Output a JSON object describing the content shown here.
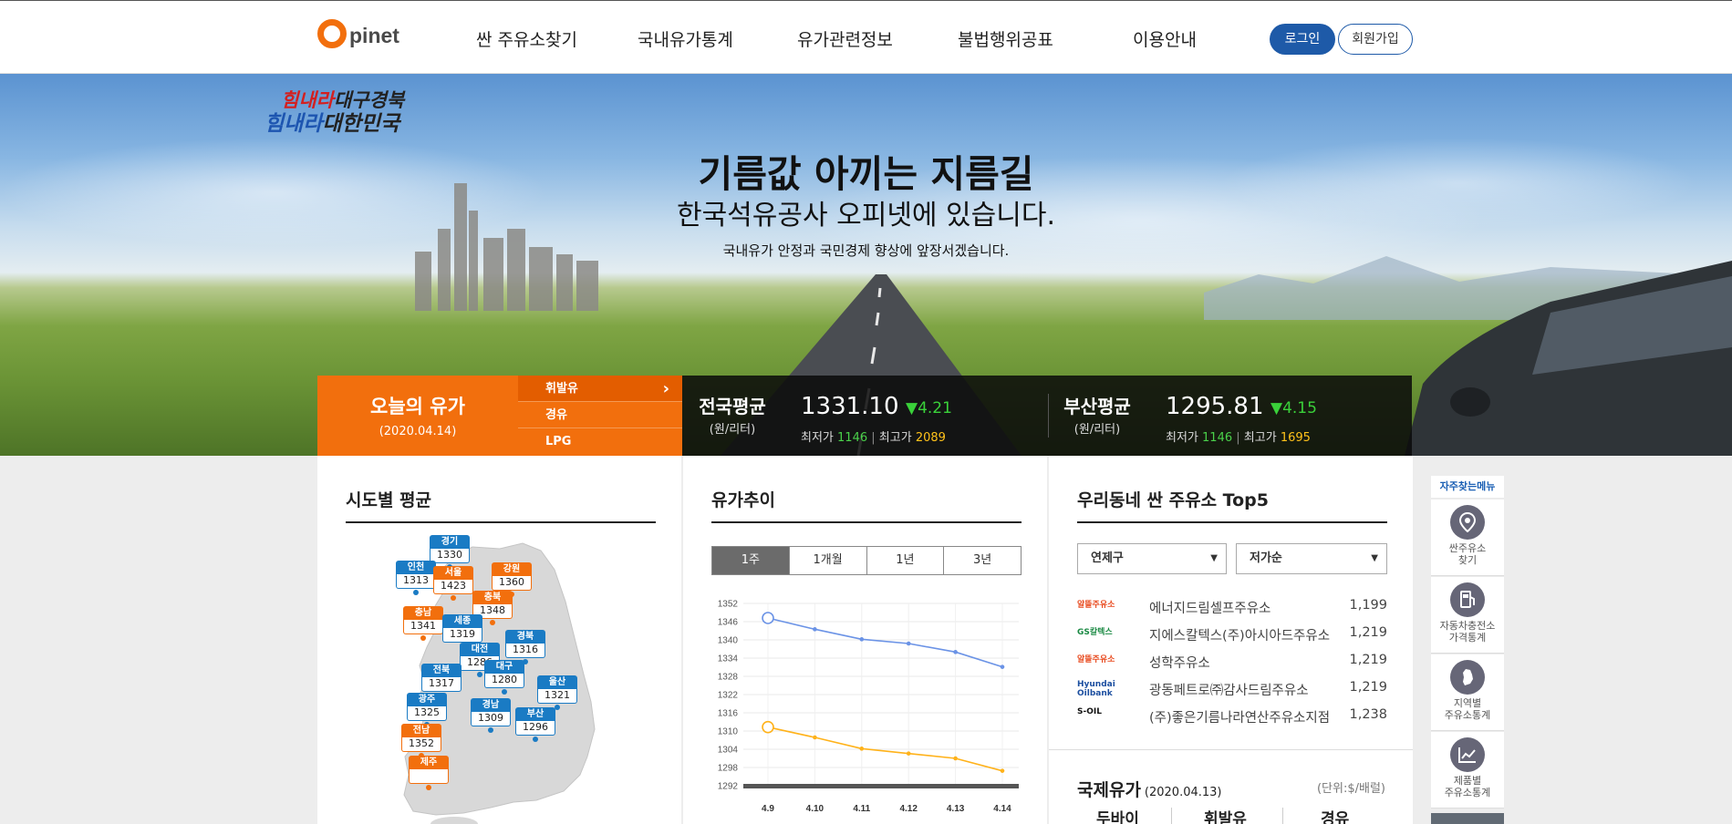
{
  "header": {
    "logo_text": "pinet",
    "nav": [
      "싼 주유소찾기",
      "국내유가통계",
      "유가관련정보",
      "불법행위공표",
      "이용안내"
    ],
    "login_label": "로그인",
    "join_label": "회원가입"
  },
  "hero": {
    "slogan_line1_accent": "힘내라",
    "slogan_line1_rest": "대구경북",
    "slogan_line2_accent": "힘내라",
    "slogan_line2_rest": "대한민국",
    "title": "기름값 아끼는 지름길",
    "subtitle": "한국석유공사 오피넷에 있습니다.",
    "description": "국내유가 안정과 국민경제 향상에 앞장서겠습니다."
  },
  "today_price": {
    "title": "오늘의 유가",
    "date": "(2020.04.14)",
    "fuel_tabs": [
      "휘발유",
      "경유",
      "LPG"
    ],
    "active_tab": "휘발유",
    "national": {
      "label": "전국평균",
      "unit": "(원/리터)",
      "price": "1331.10",
      "change": "▼4.21",
      "min_label": "최저가",
      "min": "1146",
      "max_label": "최고가",
      "max": "2089"
    },
    "local": {
      "label": "부산평균",
      "unit": "(원/리터)",
      "price": "1295.81",
      "change": "▼4.15",
      "min_label": "최저가",
      "min": "1146",
      "max_label": "최고가",
      "max": "1695"
    }
  },
  "regional": {
    "title": "시도별 평균",
    "regions": [
      {
        "name": "경기",
        "value": "1330",
        "color": "blue"
      },
      {
        "name": "인천",
        "value": "1313",
        "color": "blue"
      },
      {
        "name": "서울",
        "value": "1423",
        "color": "orange"
      },
      {
        "name": "강원",
        "value": "1360",
        "color": "orange"
      },
      {
        "name": "충북",
        "value": "1348",
        "color": "orange"
      },
      {
        "name": "충남",
        "value": "1341",
        "color": "orange"
      },
      {
        "name": "세종",
        "value": "1319",
        "color": "blue"
      },
      {
        "name": "경북",
        "value": "1316",
        "color": "blue"
      },
      {
        "name": "대전",
        "value": "1286",
        "color": "blue"
      },
      {
        "name": "전북",
        "value": "1317",
        "color": "blue"
      },
      {
        "name": "대구",
        "value": "1280",
        "color": "blue"
      },
      {
        "name": "울산",
        "value": "1321",
        "color": "blue"
      },
      {
        "name": "광주",
        "value": "1325",
        "color": "blue"
      },
      {
        "name": "경남",
        "value": "1309",
        "color": "blue"
      },
      {
        "name": "부산",
        "value": "1296",
        "color": "blue"
      },
      {
        "name": "전남",
        "value": "1352",
        "color": "orange"
      },
      {
        "name": "제주",
        "value": "",
        "color": "orange"
      }
    ]
  },
  "trend": {
    "title": "유가추이",
    "period_tabs": [
      "1주",
      "1개월",
      "1년",
      "3년"
    ],
    "active_period": "1주"
  },
  "chart_data": {
    "type": "line",
    "categories": [
      "4.9",
      "4.10",
      "4.11",
      "4.12",
      "4.13",
      "4.14"
    ],
    "series": [
      {
        "values": [
          1347.2,
          1343.5,
          1340.2,
          1338.8,
          1336.0,
          1331.1
        ],
        "color": "#6b93e6"
      },
      {
        "values": [
          1311.3,
          1307.9,
          1304.2,
          1302.6,
          1301.0,
          1296.9
        ],
        "color": "#ffb21a"
      }
    ],
    "y_ticks": [
      "1352",
      "1346",
      "1340",
      "1334",
      "1328",
      "1322",
      "1316",
      "1310",
      "1304",
      "1298",
      "1292"
    ],
    "ylim": [
      1292,
      1352
    ],
    "grid": true
  },
  "cheap_stations": {
    "title": "우리동네 싼 주유소 Top5",
    "district_select": "연제구",
    "sort_select": "저가순",
    "stations": [
      {
        "brand": "알뜰주유소",
        "brand_color": "#e8491d",
        "name": "에너지드림셀프주유소",
        "price": "1,199"
      },
      {
        "brand": "GS칼텍스",
        "brand_color": "#1b8a44",
        "name": "지에스칼텍스(주)아시아드주유소",
        "price": "1,219"
      },
      {
        "brand": "알뜰주유소",
        "brand_color": "#e8491d",
        "name": "성학주유소",
        "price": "1,219"
      },
      {
        "brand": "Hyundai Oilbank",
        "brand_color": "#1d4fa0",
        "name": "광동페트로㈜감사드림주유소",
        "price": "1,219"
      },
      {
        "brand": "S-OIL",
        "brand_color": "#111111",
        "name": "(주)좋은기름나라연산주유소지점",
        "price": "1,238"
      }
    ]
  },
  "intl": {
    "title": "국제유가",
    "date": "(2020.04.13)",
    "unit": "(단위:$/배럴)",
    "columns": [
      "두바이",
      "휘발유",
      "경유"
    ]
  },
  "quick_menu": {
    "title": "자주찾는메뉴",
    "items": [
      {
        "icon": "map-pin-icon",
        "label1": "싼주유소",
        "label2": "찾기"
      },
      {
        "icon": "charging-station-icon",
        "label1": "자동차충전소",
        "label2": "가격통계"
      },
      {
        "icon": "korea-map-icon",
        "label1": "지역별",
        "label2": "주유소통계"
      },
      {
        "icon": "line-chart-icon",
        "label1": "제품별",
        "label2": "주유소통계"
      }
    ]
  },
  "colors": {
    "brand_orange": "#f26f0d",
    "brand_blue": "#1e5aa8",
    "down_green": "#3ad13a",
    "max_yellow": "#ffc21a"
  }
}
